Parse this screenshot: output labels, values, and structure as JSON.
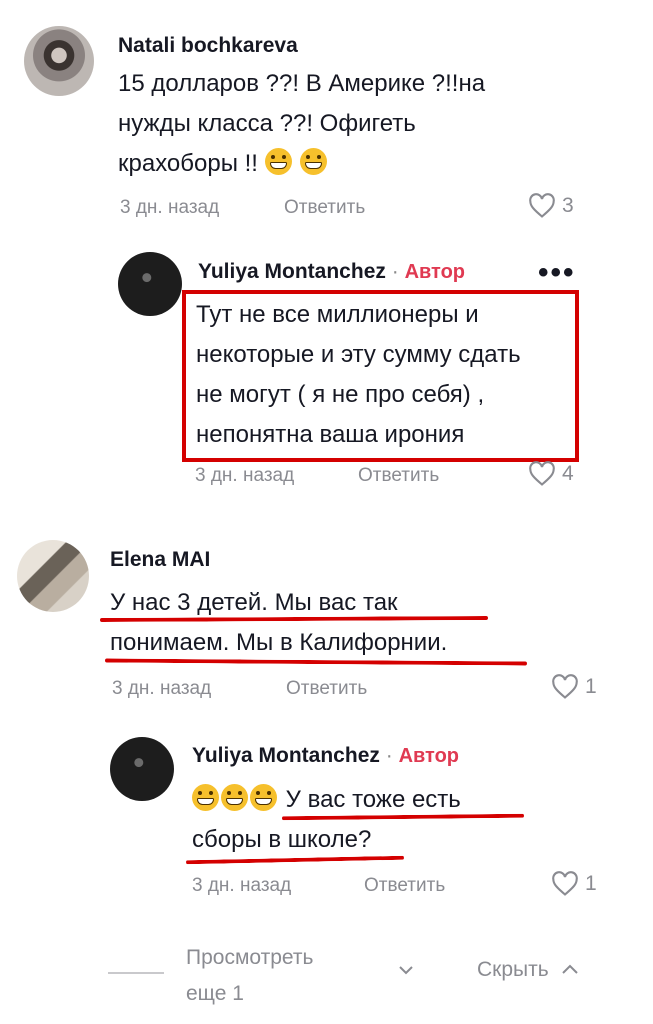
{
  "comments": [
    {
      "author": "Natali bochkareva",
      "text_lines": [
        "15 долларов ??! В Америке ?!!на",
        "нужды класса ??! Офигеть",
        "крахоборы !!"
      ],
      "emoji_count": 2,
      "time": "3 дн. назад",
      "reply_label": "Ответить",
      "likes": "3"
    },
    {
      "author": "Yuliya Montanchez",
      "author_badge": "Автор",
      "separator": "·",
      "more_label": "•••",
      "text_lines": [
        "Тут не все миллионеры и",
        "некоторые и эту сумму сдать",
        "не могут ( я не про себя) ,",
        "непонятна ваша ирония"
      ],
      "time": "3 дн. назад",
      "reply_label": "Ответить",
      "likes": "4"
    },
    {
      "author": "Elena MAI",
      "text_lines": [
        "У нас 3 детей. Мы вас так",
        "понимаем. Мы в Калифорнии."
      ],
      "time": "3 дн. назад",
      "reply_label": "Ответить",
      "likes": "1"
    },
    {
      "author": "Yuliya Montanchez",
      "author_badge": "Автор",
      "separator": "·",
      "emoji_count": 3,
      "text_lines": [
        "У вас тоже есть",
        "сборы в школе?"
      ],
      "time": "3 дн. назад",
      "reply_label": "Ответить",
      "likes": "1"
    }
  ],
  "footer": {
    "view_more_line1": "Просмотреть",
    "view_more_line2": "еще 1",
    "view_more_icon": "chevron-down-icon",
    "hide_label": "Скрыть",
    "hide_icon": "chevron-up-icon"
  },
  "colors": {
    "author_badge": "#e03a52",
    "annotation_red": "#d40000",
    "muted": "#8a8b91"
  }
}
